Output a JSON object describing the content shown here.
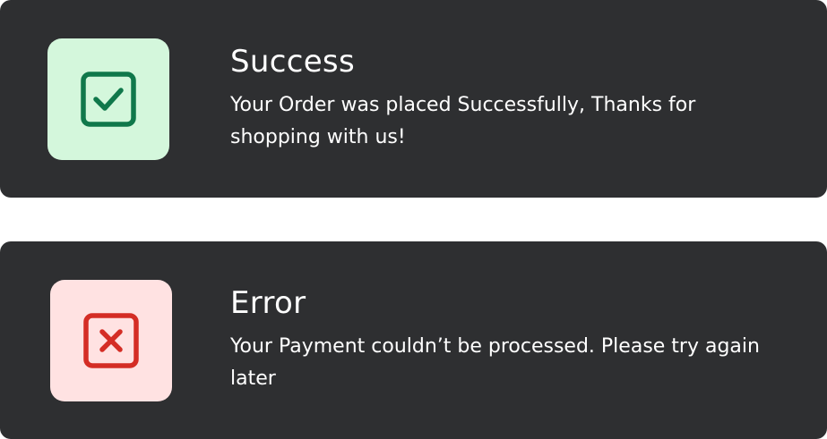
{
  "notifications": [
    {
      "type": "success",
      "title": "Success",
      "message": "Your Order was placed Successfully, Thanks for shopping with us!",
      "icon": "check-square-icon",
      "icon_bg": "#d4f7dc",
      "icon_color": "#10784b"
    },
    {
      "type": "error",
      "title": "Error",
      "message": "Your Payment couldn’t be processed. Please try again later",
      "icon": "x-square-icon",
      "icon_bg": "#ffe2e2",
      "icon_color": "#d42d25"
    }
  ],
  "theme": {
    "card_bg": "#2e2f31",
    "text_color": "#ffffff",
    "page_bg": "#ffffff"
  }
}
